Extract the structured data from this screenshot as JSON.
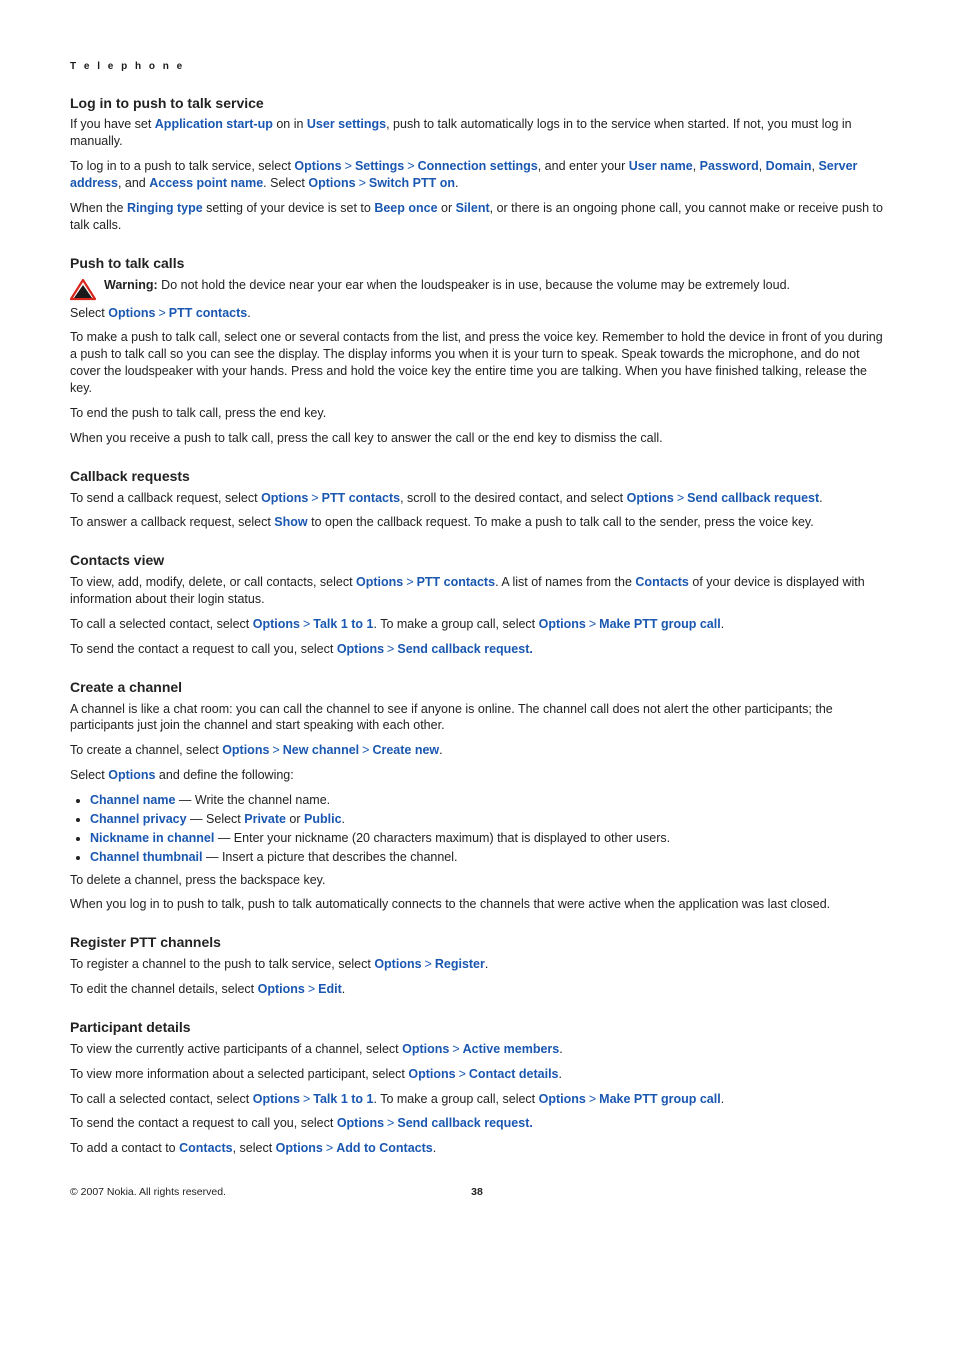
{
  "running_header": "T e l e p h o n e",
  "sec1_title": "Log in to push to talk service",
  "sec1_p1_a": "If you have set ",
  "sec1_p1_link1": "Application start-up",
  "sec1_p1_b": " on in ",
  "sec1_p1_link2": "User settings",
  "sec1_p1_c": ", push to talk automatically logs in to the service when started. If not, you must log in manually.",
  "sec1_p2_a": "To log in to a push to talk service, select ",
  "sec1_p2_options": "Options",
  "sec1_p2_settings": "Settings",
  "sec1_p2_connset": "Connection settings",
  "sec1_p2_b": ", and enter your ",
  "sec1_p2_username": "User name",
  "sec1_p2_c": ", ",
  "sec1_p2_password": "Password",
  "sec1_p2_d": ", ",
  "sec1_p2_domain": "Domain",
  "sec1_p2_e": ", ",
  "sec1_p2_serveraddr": "Server address",
  "sec1_p2_f": ", and ",
  "sec1_p2_apn": "Access point name",
  "sec1_p2_g": ". Select ",
  "sec1_p2_options2": "Options",
  "sec1_p2_switchon": "Switch PTT on",
  "sec1_p2_h": ".",
  "sec1_p3_a": "When the ",
  "sec1_p3_ringtype": "Ringing type",
  "sec1_p3_b": " setting of your device is set to ",
  "sec1_p3_beep": "Beep once",
  "sec1_p3_c": " or ",
  "sec1_p3_silent": "Silent",
  "sec1_p3_d": ", or there is an ongoing phone call, you cannot make or receive push to talk calls.",
  "sec2_title": "Push to talk calls",
  "sec2_warn_label": "Warning:  ",
  "sec2_warn_text": "Do not hold the device near your ear when the loudspeaker is in use, because the volume may be extremely loud.",
  "sec2_sel_a": "Select ",
  "sec2_sel_options": "Options",
  "sec2_sel_pttcontacts": "PTT contacts",
  "sec2_sel_b": ".",
  "sec2_p1": "To make a push to talk call, select one or several contacts from the list, and press the voice key. Remember to hold the device in front of you during a push to talk call so you can see the display. The display informs you when it is your turn to speak. Speak towards the microphone, and do not cover the loudspeaker with your hands. Press and hold the voice key the entire time you are talking. When you have finished talking, release the key.",
  "sec2_p2": "To end the push to talk call, press the end key.",
  "sec2_p3": "When you receive a push to talk call, press the call key to answer the call or the end key to dismiss the call.",
  "sec3_title": "Callback requests",
  "sec3_p1_a": "To send a callback request, select ",
  "sec3_p1_options": "Options",
  "sec3_p1_pttcontacts": "PTT contacts",
  "sec3_p1_b": ", scroll to the desired contact, and select ",
  "sec3_p1_options2": "Options",
  "sec3_p1_sendcb": "Send callback request",
  "sec3_p1_c": ".",
  "sec3_p2_a": "To answer a callback request, select ",
  "sec3_p2_show": "Show",
  "sec3_p2_b": " to open the callback request. To make a push to talk call to the sender, press the voice key.",
  "sec4_title": "Contacts view",
  "sec4_p1_a": "To view, add, modify, delete, or call contacts, select ",
  "sec4_p1_options": "Options",
  "sec4_p1_pttcontacts": "PTT contacts",
  "sec4_p1_b": ". A list of names from the ",
  "sec4_p1_contacts": "Contacts",
  "sec4_p1_c": " of your device is displayed with information about their login status.",
  "sec4_p2_a": "To call a selected contact, select ",
  "sec4_p2_options": "Options",
  "sec4_p2_talk": "Talk 1 to 1",
  "sec4_p2_b": ". To make a group call, select ",
  "sec4_p2_options2": "Options",
  "sec4_p2_groupcall": "Make PTT group call",
  "sec4_p2_c": ".",
  "sec4_p3_a": "To send the contact a request to call you, select ",
  "sec4_p3_options": "Options",
  "sec4_p3_sendcb": "Send callback request.",
  "sec5_title": "Create a channel",
  "sec5_p1": "A channel is like a chat room: you can call the channel to see if anyone is online. The channel call does not alert the other participants; the participants just join the channel and start speaking with each other.",
  "sec5_p2_a": "To create a channel, select ",
  "sec5_p2_options": "Options",
  "sec5_p2_newch": "New channel",
  "sec5_p2_createnew": "Create new",
  "sec5_p2_b": ".",
  "sec5_p3_a": "Select ",
  "sec5_p3_options": "Options",
  "sec5_p3_b": " and define the following:",
  "sec5_li1_link": "Channel name",
  "sec5_li1_text": "  — Write the channel name.",
  "sec5_li2_link": "Channel privacy",
  "sec5_li2_a": "  — Select ",
  "sec5_li2_private": "Private",
  "sec5_li2_b": " or ",
  "sec5_li2_public": "Public",
  "sec5_li2_c": ".",
  "sec5_li3_link": "Nickname in channel",
  "sec5_li3_text": "  — Enter your nickname (20 characters maximum) that is displayed to other users.",
  "sec5_li4_link": "Channel thumbnail",
  "sec5_li4_text": "  — Insert a picture that describes the channel.",
  "sec5_p4": "To delete a channel, press the backspace key.",
  "sec5_p5": "When you log in to push to talk, push to talk automatically connects to the channels that were active when the application was last closed.",
  "sec6_title": "Register PTT channels",
  "sec6_p1_a": "To register a channel to the push to talk service, select ",
  "sec6_p1_options": "Options",
  "sec6_p1_register": "Register",
  "sec6_p1_b": ".",
  "sec6_p2_a": "To edit the channel details, select ",
  "sec6_p2_options": "Options",
  "sec6_p2_edit": "Edit",
  "sec6_p2_b": ".",
  "sec7_title": "Participant details",
  "sec7_p1_a": "To view the currently active participants of a channel, select ",
  "sec7_p1_options": "Options",
  "sec7_p1_activem": "Active members",
  "sec7_p1_b": ".",
  "sec7_p2_a": "To view more information about a selected participant, select ",
  "sec7_p2_options": "Options",
  "sec7_p2_cdetails": "Contact details",
  "sec7_p2_b": ".",
  "sec7_p3_a": "To call a selected contact, select ",
  "sec7_p3_options": "Options",
  "sec7_p3_talk": "Talk 1 to 1",
  "sec7_p3_b": ". To make a group call, select ",
  "sec7_p3_options2": "Options",
  "sec7_p3_groupcall": "Make PTT group call",
  "sec7_p3_c": ".",
  "sec7_p4_a": "To send the contact a request to call you, select ",
  "sec7_p4_options": "Options",
  "sec7_p4_sendcb": "Send callback request.",
  "sec7_p5_a": "To add a contact to ",
  "sec7_p5_contacts": "Contacts",
  "sec7_p5_b": ", select ",
  "sec7_p5_options": "Options",
  "sec7_p5_addto": "Add to Contacts",
  "sec7_p5_c": ".",
  "sep": ">",
  "footer_left": "© 2007 Nokia. All rights reserved.",
  "footer_page": "38"
}
